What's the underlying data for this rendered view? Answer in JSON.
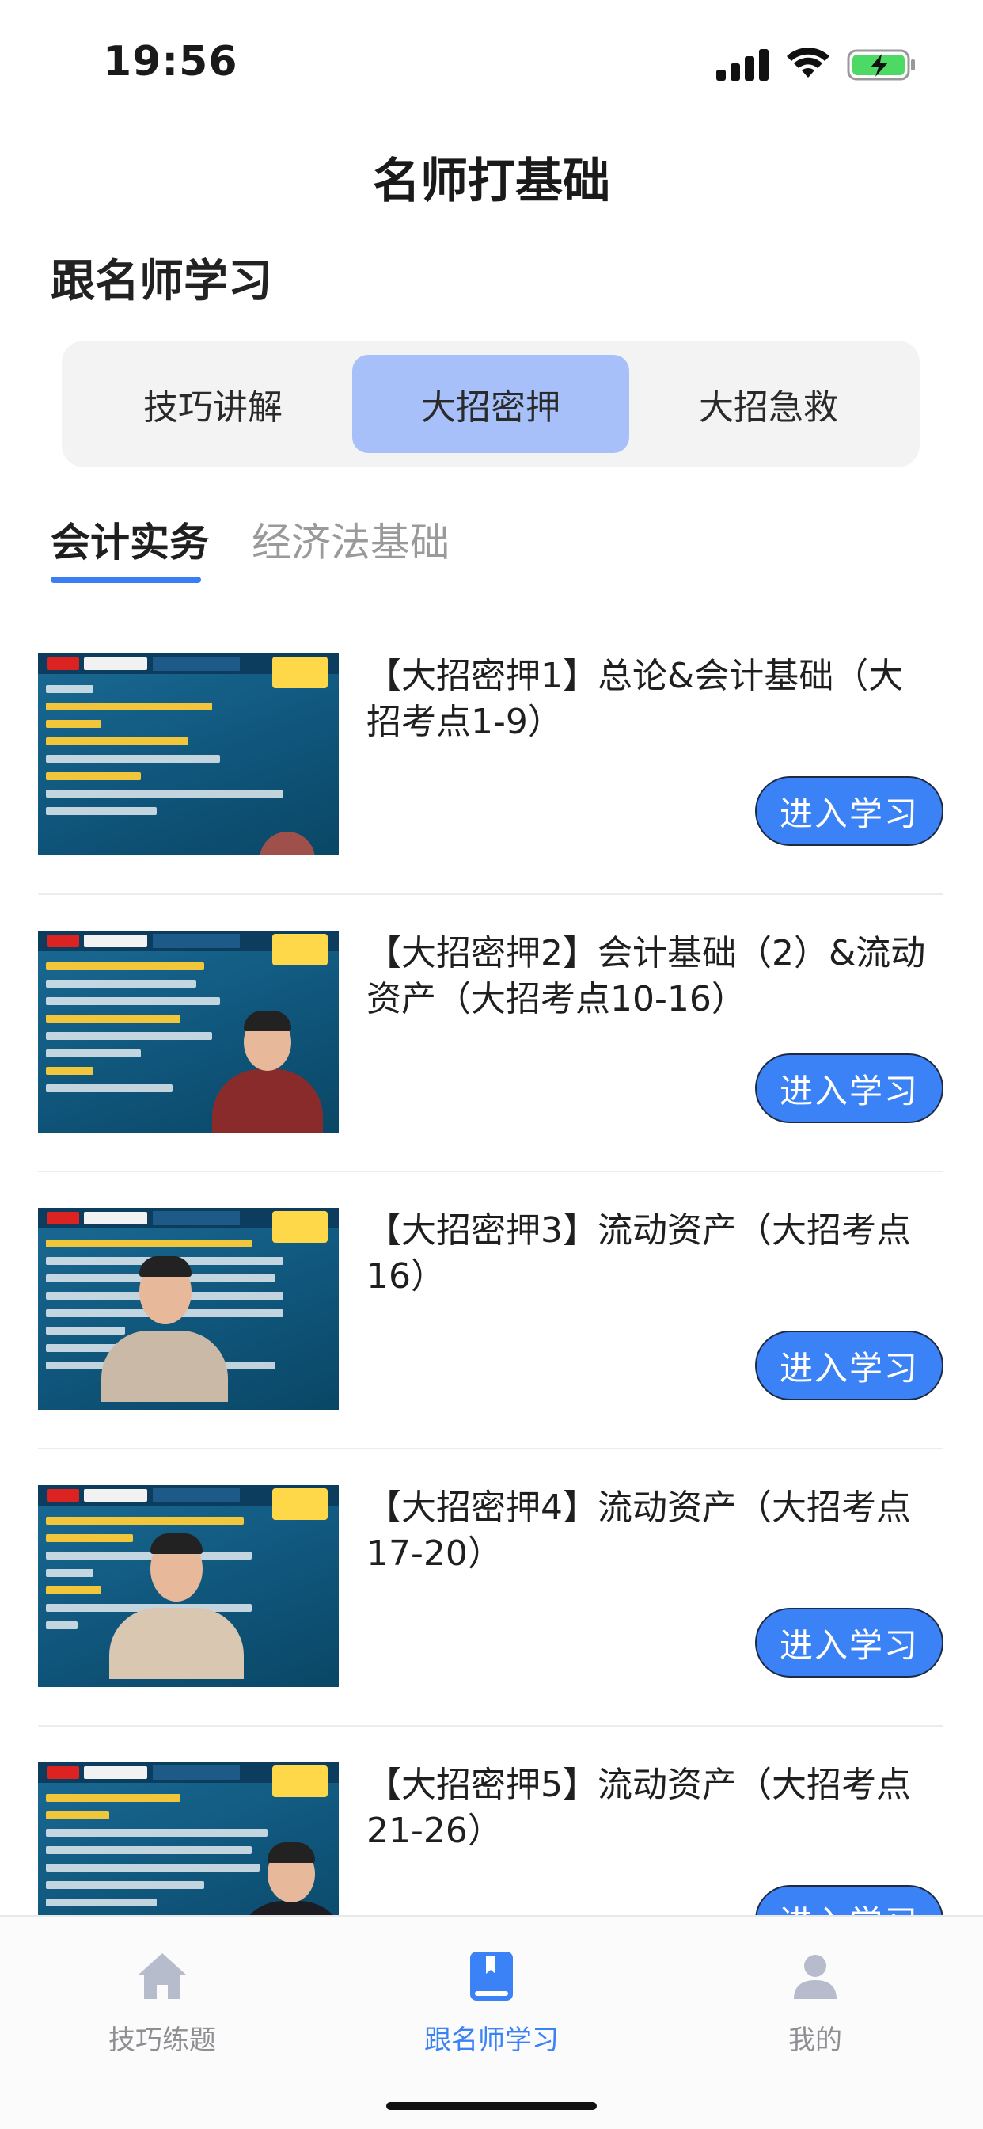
{
  "status_bar": {
    "time": "19:56"
  },
  "header": {
    "title": "名师打基础",
    "section_title": "跟名师学习"
  },
  "segments": [
    {
      "label": "技巧讲解",
      "active": false
    },
    {
      "label": "大招密押",
      "active": true
    },
    {
      "label": "大招急救",
      "active": false
    }
  ],
  "subject_tabs": [
    {
      "label": "会计实务",
      "active": true
    },
    {
      "label": "经济法基础",
      "active": false
    }
  ],
  "courses": [
    {
      "title": "【大招密押1】总论&会计基础（大招考点1-9）",
      "button": "进入学习",
      "thumbnail": "lecture-slide-thumbnail"
    },
    {
      "title": "【大招密押2】会计基础（2）&流动资产（大招考点10-16）",
      "button": "进入学习",
      "thumbnail": "lecture-video-thumbnail"
    },
    {
      "title": "【大招密押3】流动资产（大招考点16）",
      "button": "进入学习",
      "thumbnail": "lecture-video-thumbnail"
    },
    {
      "title": "【大招密押4】流动资产（大招考点17-20）",
      "button": "进入学习",
      "thumbnail": "lecture-video-thumbnail"
    },
    {
      "title": "【大招密押5】流动资产（大招考点21-26）",
      "button": "进入学习",
      "thumbnail": "lecture-video-thumbnail"
    }
  ],
  "tab_bar": [
    {
      "label": "技巧练题",
      "icon": "home-icon",
      "active": false
    },
    {
      "label": "跟名师学习",
      "icon": "book-icon",
      "active": true
    },
    {
      "label": "我的",
      "icon": "person-icon",
      "active": false
    }
  ],
  "colors": {
    "accent": "#3b82f6",
    "segment_active": "#a8c0fa",
    "thumbnail_bg": "#0f5479"
  }
}
